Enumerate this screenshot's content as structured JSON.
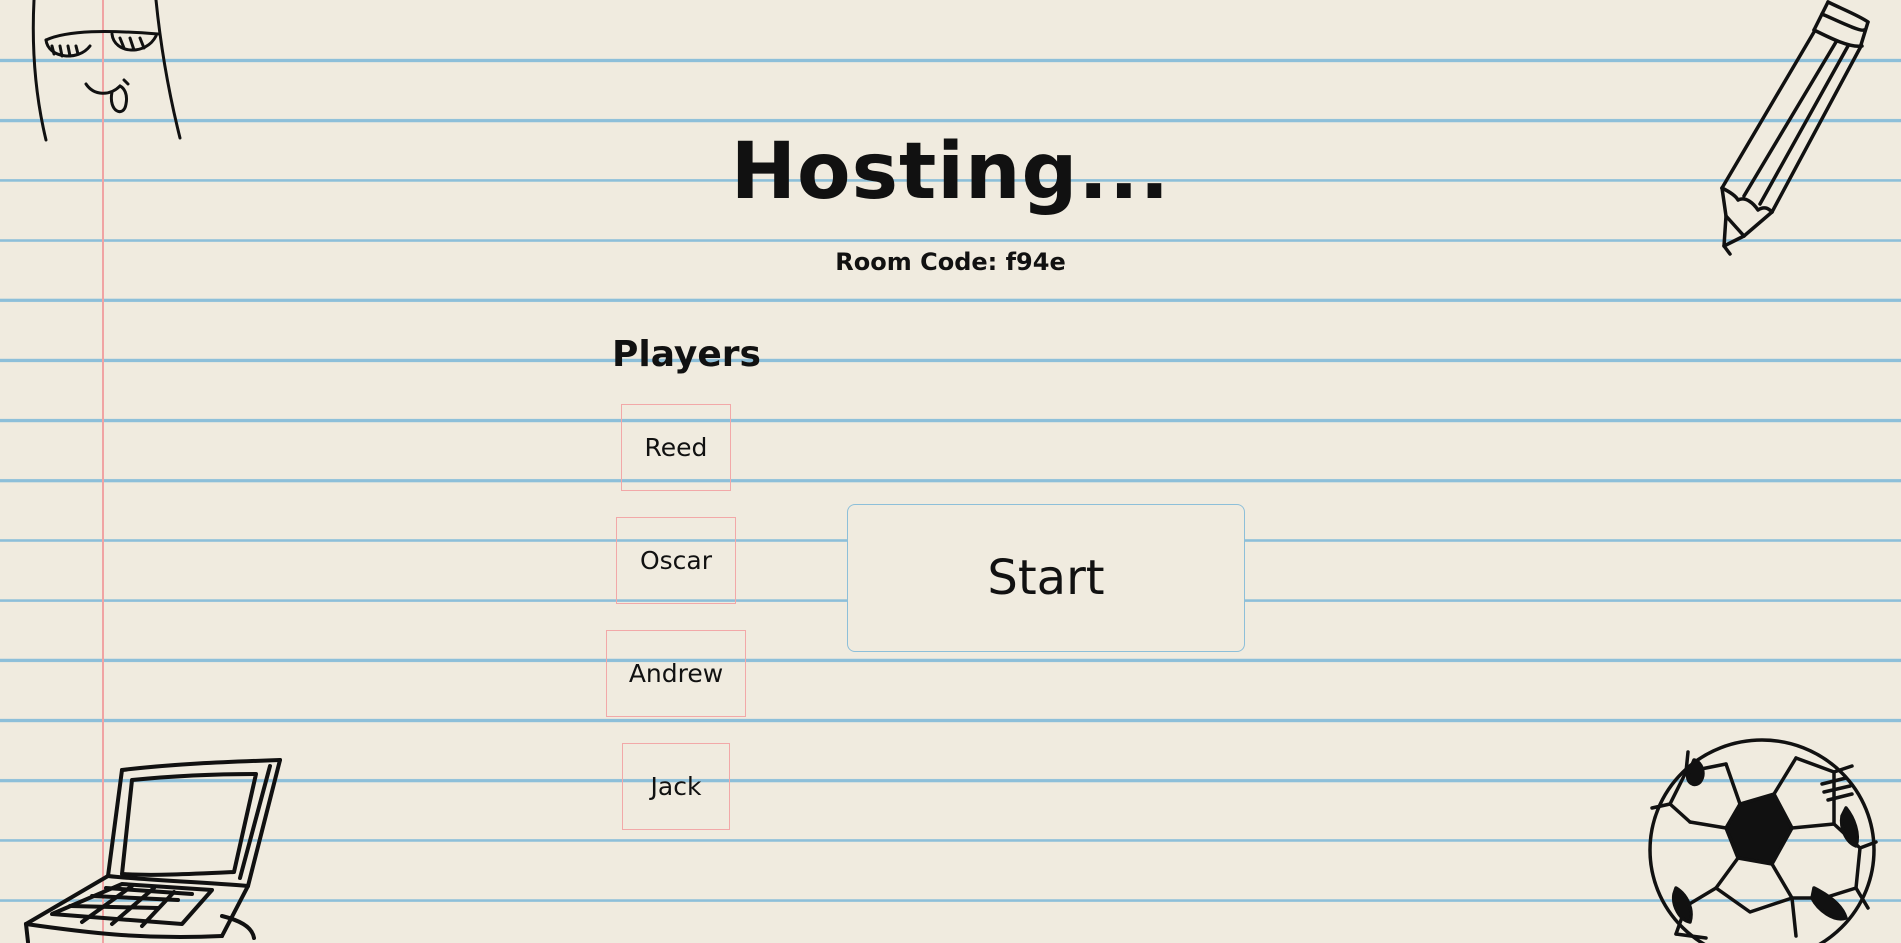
{
  "title": "Hosting...",
  "room_code": "Room Code: f94e",
  "players_heading": "Players",
  "players": [
    "Reed",
    "Oscar",
    "Andrew",
    "Jack"
  ],
  "start_button": "Start",
  "colors": {
    "paper": "#f0ebdf",
    "rule_line": "#8dbfd9",
    "margin_line": "#f0a3a3",
    "player_border": "#f2a8a8",
    "start_border": "#8dbfd9"
  },
  "doodles": [
    "face-doodle-icon",
    "pencil-doodle-icon",
    "laptop-doodle-icon",
    "soccer-ball-doodle-icon"
  ]
}
